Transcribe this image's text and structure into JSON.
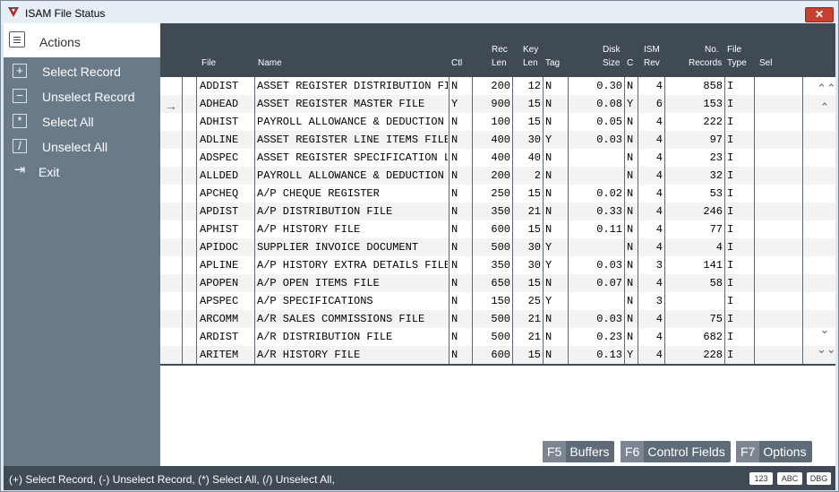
{
  "window": {
    "title": "ISAM File Status",
    "close_glyph": "✕"
  },
  "actions": {
    "header": "Actions",
    "items": [
      {
        "label": "Select Record",
        "icon": "plus-box-icon",
        "glyph": "+"
      },
      {
        "label": "Unselect Record",
        "icon": "minus-box-icon",
        "glyph": "−"
      },
      {
        "label": "Select All",
        "icon": "asterisk-box-icon",
        "glyph": "*"
      },
      {
        "label": "Unselect All",
        "icon": "slash-box-icon",
        "glyph": "/"
      },
      {
        "label": "Exit",
        "icon": "exit-arrow-icon",
        "glyph": "⇥"
      }
    ]
  },
  "grid": {
    "columns": {
      "file": "File",
      "name": "Name",
      "ctl": "Ctl",
      "rec_len_1": "Rec",
      "rec_len_2": "Len",
      "key_len_1": "Key",
      "key_len_2": "Len",
      "tag": "Tag",
      "disk_size_1": "Disk",
      "disk_size_2": "Size",
      "c": "C",
      "ism_rev_1": "ISM",
      "ism_rev_2": "Rev",
      "records_1": "No.",
      "records_2": "Records",
      "file_type_1": "File",
      "file_type_2": "Type",
      "sel": "Sel"
    },
    "rows": [
      [
        "ADDIST",
        "ASSET REGISTER DISTRIBUTION FI",
        "N",
        "200",
        "12",
        "N",
        "0.30",
        "N",
        "4",
        "858",
        "I"
      ],
      [
        "ADHEAD",
        "ASSET REGISTER MASTER FILE",
        "Y",
        "900",
        "15",
        "N",
        "0.08",
        "Y",
        "6",
        "153",
        "I"
      ],
      [
        "ADHIST",
        "PAYROLL ALLOWANCE & DEDUCTION",
        "N",
        "100",
        "15",
        "N",
        "0.05",
        "N",
        "4",
        "222",
        "I"
      ],
      [
        "ADLINE",
        "ASSET REGISTER LINE ITEMS FILE",
        "N",
        "400",
        "30",
        "Y",
        "0.03",
        "N",
        "4",
        "97",
        "I"
      ],
      [
        "ADSPEC",
        "ASSET REGISTER SPECIFICATION L",
        "N",
        "400",
        "40",
        "N",
        "",
        "N",
        "4",
        "23",
        "I"
      ],
      [
        "ALLDED",
        "PAYROLL ALLOWANCE & DEDUCTION",
        "N",
        "200",
        "2",
        "N",
        "",
        "N",
        "4",
        "32",
        "I"
      ],
      [
        "APCHEQ",
        "A/P CHEQUE REGISTER",
        "N",
        "250",
        "15",
        "N",
        "0.02",
        "N",
        "4",
        "53",
        "I"
      ],
      [
        "APDIST",
        "A/P DISTRIBUTION FILE",
        "N",
        "350",
        "21",
        "N",
        "0.33",
        "N",
        "4",
        "246",
        "I"
      ],
      [
        "APHIST",
        "A/P HISTORY FILE",
        "N",
        "600",
        "15",
        "N",
        "0.11",
        "N",
        "4",
        "77",
        "I"
      ],
      [
        "APIDOC",
        "SUPPLIER INVOICE DOCUMENT",
        "N",
        "500",
        "30",
        "Y",
        "",
        "N",
        "4",
        "4",
        "I"
      ],
      [
        "APLINE",
        "A/P HISTORY EXTRA DETAILS FILE",
        "N",
        "350",
        "30",
        "Y",
        "0.03",
        "N",
        "3",
        "141",
        "I"
      ],
      [
        "APOPEN",
        "A/P OPEN ITEMS FILE",
        "N",
        "650",
        "15",
        "N",
        "0.07",
        "N",
        "4",
        "58",
        "I"
      ],
      [
        "APSPEC",
        "A/P SPECIFICATIONS",
        "N",
        "150",
        "25",
        "Y",
        "",
        "N",
        "3",
        "",
        "I"
      ],
      [
        "ARCOMM",
        "A/R SALES COMMISSIONS FILE",
        "N",
        "500",
        "21",
        "N",
        "0.03",
        "N",
        "4",
        "75",
        "I"
      ],
      [
        "ARDIST",
        "A/R DISTRIBUTION FILE",
        "N",
        "500",
        "21",
        "N",
        "0.23",
        "N",
        "4",
        "682",
        "I"
      ],
      [
        "ARITEM",
        "A/R HISTORY FILE",
        "N",
        "600",
        "15",
        "N",
        "0.13",
        "Y",
        "4",
        "228",
        "I"
      ]
    ],
    "row_pointer": "→"
  },
  "scroll": {
    "top": "⌃⌃",
    "up": "⌃",
    "down": "⌄",
    "bottom": "⌄⌄"
  },
  "function_keys": [
    {
      "key": "F5",
      "label": "Buffers"
    },
    {
      "key": "F6",
      "label": "Control Fields"
    },
    {
      "key": "F7",
      "label": "Options"
    }
  ],
  "status": {
    "text": "(+) Select Record, (-) Unselect Record, (*) Select All, (/) Unselect All,",
    "badges": [
      "123",
      "ABC",
      "DBG"
    ]
  }
}
